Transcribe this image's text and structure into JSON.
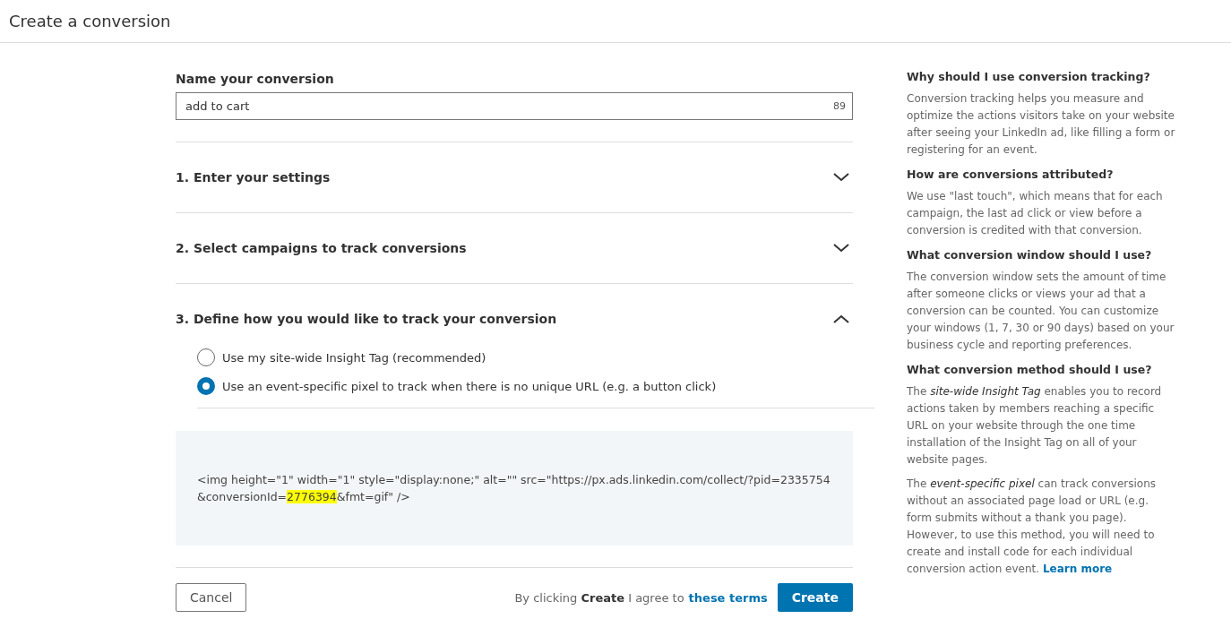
{
  "header": {
    "title": "Create a conversion"
  },
  "name_field": {
    "label": "Name your conversion",
    "value": "add to cart",
    "counter": "89"
  },
  "sections": [
    {
      "title": "1. Enter your settings",
      "expanded": false
    },
    {
      "title": "2. Select campaigns to track conversions",
      "expanded": false
    },
    {
      "title": "3. Define how you would like to track your conversion",
      "expanded": true,
      "options": [
        {
          "label": "Use my site-wide Insight Tag (recommended)",
          "selected": false
        },
        {
          "label": "Use an event-specific pixel to track when there is no unique URL (e.g. a button click)",
          "selected": true
        }
      ]
    }
  ],
  "code": {
    "before": "<img height=\"1\" width=\"1\" style=\"display:none;\" alt=\"\" src=\"https://px.ads.linkedin.com/collect/?pid=2335754&conversionId=",
    "highlight": "2776394",
    "after": "&fmt=gif\" />"
  },
  "footer": {
    "cancel": "Cancel",
    "agreement": "By clicking **Create** I agree to",
    "terms_link": "these terms",
    "create": "Create"
  },
  "help": [
    {
      "heading": "Why should I use conversion tracking?",
      "paragraphs": [
        {
          "text": "Conversion tracking helps you measure and optimize the actions visitors take on your website after seeing your LinkedIn ad, like filling a form or registering for an event."
        }
      ]
    },
    {
      "heading": "How are conversions attributed?",
      "paragraphs": [
        {
          "text": "We use \"last touch\", which means that for each campaign, the last ad click or view before a conversion is credited with that conversion."
        }
      ]
    },
    {
      "heading": "What conversion window should I use?",
      "paragraphs": [
        {
          "text": "The conversion window sets the amount of time after someone clicks or views your ad that a conversion can be counted. You can customize your windows (1, 7, 30 or 90 days) based on your business cycle and reporting preferences."
        }
      ]
    },
    {
      "heading": "What conversion method should I use?",
      "paragraphs": [
        {
          "text": "The *site-wide Insight Tag* enables you to record actions taken by members reaching a specific URL on your website through the one time installation of the Insight Tag on all of your website pages."
        },
        {
          "text": "The *event-specific pixel* can track conversions without an associated page load or URL (e.g. form submits without a thank you page). However, to use this method, you will need to create and install code for each individual conversion action event.",
          "link": "Learn more"
        }
      ]
    }
  ]
}
